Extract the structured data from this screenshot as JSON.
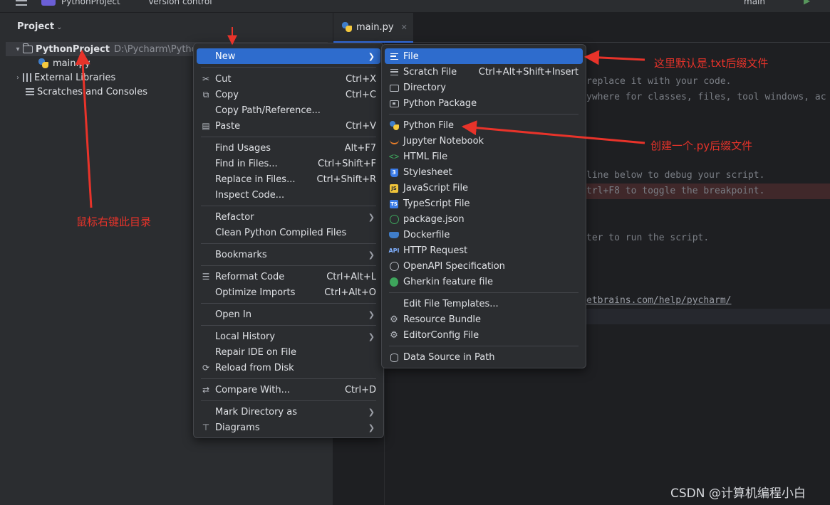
{
  "topbar": {
    "project_name": "PythonProject",
    "vcs": "Version control",
    "branch": "main"
  },
  "project_panel": {
    "title": "Project",
    "tree": [
      {
        "label": "PythonProject",
        "path": "D:\\Pycharm\\Python"
      },
      {
        "label": "main.py"
      },
      {
        "label": "External Libraries"
      },
      {
        "label": "Scratches and Consoles"
      }
    ]
  },
  "editor": {
    "tab_label": "main.py",
    "lines": [
      "replace it with your code.",
      "ywhere for classes, files, tool windows, ac",
      "line below to debug your script.",
      "trl+F8 to toggle the breakpoint.",
      "ter to run the script.",
      "etbrains.com/help/pycharm/"
    ]
  },
  "context_menu": {
    "items": [
      {
        "label": "New",
        "shortcut": "",
        "submenu": true
      },
      {
        "label": "Cut",
        "shortcut": "Ctrl+X"
      },
      {
        "label": "Copy",
        "shortcut": "Ctrl+C"
      },
      {
        "label": "Copy Path/Reference...",
        "shortcut": ""
      },
      {
        "label": "Paste",
        "shortcut": "Ctrl+V"
      },
      {
        "label": "Find Usages",
        "shortcut": "Alt+F7"
      },
      {
        "label": "Find in Files...",
        "shortcut": "Ctrl+Shift+F"
      },
      {
        "label": "Replace in Files...",
        "shortcut": "Ctrl+Shift+R"
      },
      {
        "label": "Inspect Code...",
        "shortcut": ""
      },
      {
        "label": "Refactor",
        "shortcut": "",
        "submenu": true
      },
      {
        "label": "Clean Python Compiled Files",
        "shortcut": ""
      },
      {
        "label": "Bookmarks",
        "shortcut": "",
        "submenu": true
      },
      {
        "label": "Reformat Code",
        "shortcut": "Ctrl+Alt+L"
      },
      {
        "label": "Optimize Imports",
        "shortcut": "Ctrl+Alt+O"
      },
      {
        "label": "Open In",
        "shortcut": "",
        "submenu": true
      },
      {
        "label": "Local History",
        "shortcut": "",
        "submenu": true
      },
      {
        "label": "Repair IDE on File",
        "shortcut": ""
      },
      {
        "label": "Reload from Disk",
        "shortcut": ""
      },
      {
        "label": "Compare With...",
        "shortcut": "Ctrl+D"
      },
      {
        "label": "Mark Directory as",
        "shortcut": "",
        "submenu": true
      },
      {
        "label": "Diagrams",
        "shortcut": "",
        "submenu": true
      }
    ]
  },
  "new_submenu": {
    "items": [
      {
        "label": "File",
        "shortcut": ""
      },
      {
        "label": "Scratch File",
        "shortcut": "Ctrl+Alt+Shift+Insert"
      },
      {
        "label": "Directory",
        "shortcut": ""
      },
      {
        "label": "Python Package",
        "shortcut": ""
      },
      {
        "label": "Python File",
        "shortcut": ""
      },
      {
        "label": "Jupyter Notebook",
        "shortcut": ""
      },
      {
        "label": "HTML File",
        "shortcut": ""
      },
      {
        "label": "Stylesheet",
        "shortcut": ""
      },
      {
        "label": "JavaScript File",
        "shortcut": ""
      },
      {
        "label": "TypeScript File",
        "shortcut": ""
      },
      {
        "label": "package.json",
        "shortcut": ""
      },
      {
        "label": "Dockerfile",
        "shortcut": ""
      },
      {
        "label": "HTTP Request",
        "shortcut": ""
      },
      {
        "label": "OpenAPI Specification",
        "shortcut": ""
      },
      {
        "label": "Gherkin feature file",
        "shortcut": ""
      },
      {
        "label": "Edit File Templates...",
        "shortcut": ""
      },
      {
        "label": "Resource Bundle",
        "shortcut": ""
      },
      {
        "label": "EditorConfig File",
        "shortcut": ""
      },
      {
        "label": "Data Source in Path",
        "shortcut": ""
      }
    ]
  },
  "annotations": {
    "right_click": "鼠标右键此目录",
    "file_note": "这里默认是.txt后缀文件",
    "python_note": "创建一个.py后缀文件",
    "color": "#e8332a"
  },
  "watermark": "CSDN @计算机编程小白",
  "colors": {
    "accent": "#2e6ccd",
    "background": "#1e1f22",
    "panel": "#2b2d30"
  }
}
